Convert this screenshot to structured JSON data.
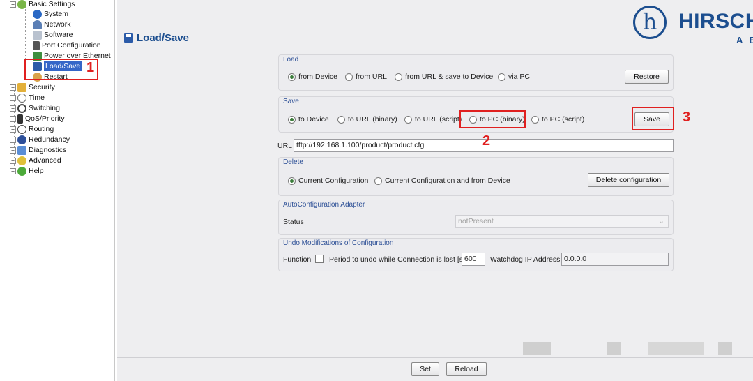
{
  "tree": {
    "root_label": "Basic Settings",
    "basic_children": [
      "System",
      "Network",
      "Software",
      "Port Configuration",
      "Power over Ethernet",
      "Load/Save",
      "Restart"
    ],
    "groups": [
      "Security",
      "Time",
      "Switching",
      "QoS/Priority",
      "Routing",
      "Redundancy",
      "Diagnostics",
      "Advanced",
      "Help"
    ],
    "expand_symbol_open": "−",
    "expand_symbol_closed": "+"
  },
  "header": {
    "page_title": "Load/Save",
    "logo_glyph": "h",
    "logo_text": "HIRSCH",
    "logo_sub": "A B"
  },
  "load": {
    "title": "Load",
    "options": [
      "from Device",
      "from URL",
      "from URL & save to Device",
      "via PC"
    ],
    "selected": "from Device",
    "button": "Restore"
  },
  "save": {
    "title": "Save",
    "options": [
      "to Device",
      "to URL (binary)",
      "to URL (script)",
      "to PC (binary)",
      "to PC (script)"
    ],
    "selected": "to Device",
    "button": "Save"
  },
  "url": {
    "label": "URL",
    "value": "tftp://192.168.1.100/product/product.cfg"
  },
  "delete": {
    "title": "Delete",
    "options": [
      "Current Configuration",
      "Current Configuration and from Device"
    ],
    "selected": "Current Configuration",
    "button": "Delete configuration"
  },
  "autoconfig": {
    "title": "AutoConfiguration Adapter",
    "status_label": "Status",
    "status_value": "notPresent"
  },
  "undo": {
    "title": "Undo Modifications of Configuration",
    "function_label": "Function",
    "period_label": "Period to undo while Connection is lost [s]",
    "period_value": "600",
    "watchdog_label": "Watchdog IP Address",
    "watchdog_value": "0.0.0.0"
  },
  "footer": {
    "set_button": "Set",
    "reload_button": "Reload"
  },
  "annotations": {
    "marker_1": "1",
    "marker_2": "2",
    "marker_3": "3",
    "color": "#e02020"
  }
}
